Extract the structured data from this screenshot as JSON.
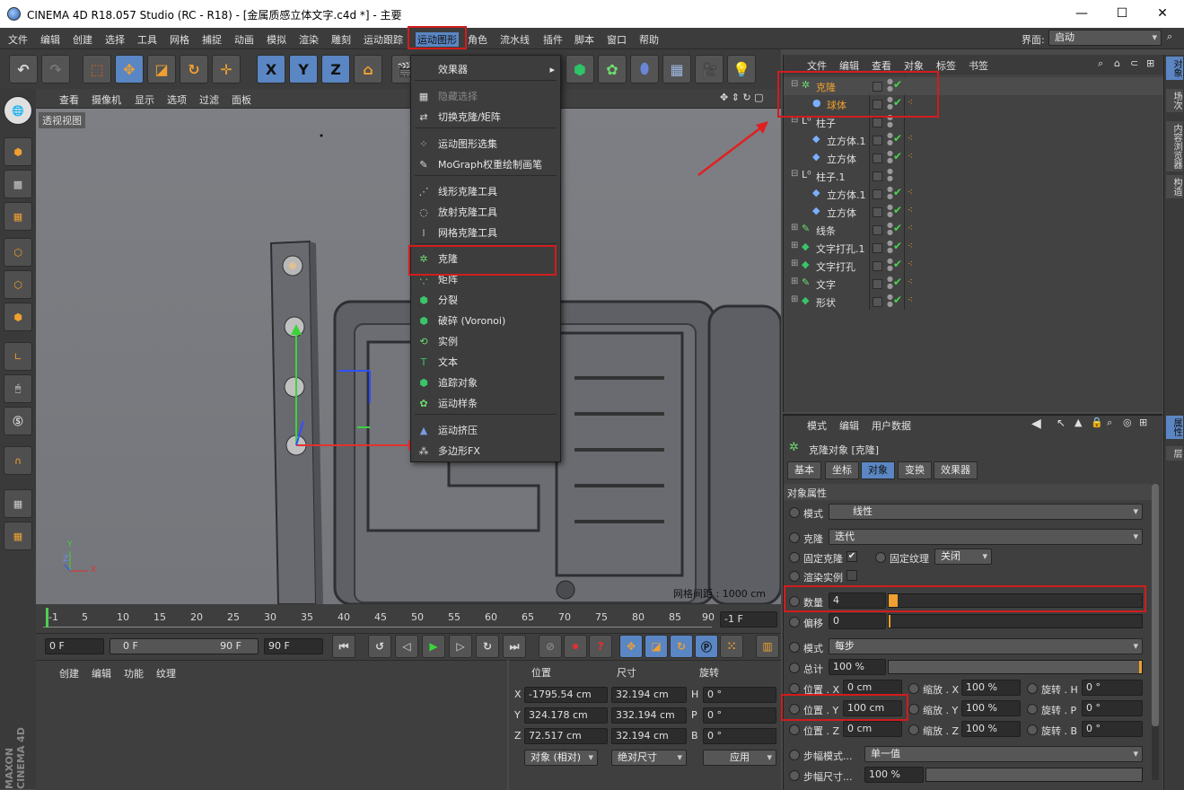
{
  "window": {
    "title": "CINEMA 4D R18.057 Studio (RC - R18) - [金属质感立体文字.c4d *] - 主要",
    "minimize": "—",
    "maximize": "☐",
    "close": "✕"
  },
  "menubar": {
    "items": [
      "文件",
      "编辑",
      "创建",
      "选择",
      "工具",
      "网格",
      "捕捉",
      "动画",
      "模拟",
      "渲染",
      "雕刻",
      "运动跟踪",
      "运动图形",
      "角色",
      "流水线",
      "插件",
      "脚本",
      "窗口",
      "帮助"
    ],
    "layout_label": "界面:",
    "layout_value": "启动"
  },
  "toolbar": {
    "x": "X",
    "y": "Y",
    "z": "Z"
  },
  "viewport": {
    "menu": [
      "查看",
      "摄像机",
      "显示",
      "选项",
      "过滤",
      "面板"
    ],
    "view_name": "透视视图",
    "grid_spacing": "网格间距 : 1000 cm",
    "axis_y": "Y",
    "axis_z": "Z",
    "axis_x": "X"
  },
  "dropdown": {
    "items": [
      {
        "label": "效果器",
        "submenu": true,
        "disabled": false,
        "icon": "effector-icon"
      },
      {
        "label": "隐藏选择",
        "disabled": true,
        "icon": "hide-selection-icon"
      },
      {
        "label": "切换克隆/矩阵",
        "disabled": false,
        "icon": "toggle-clone-icon"
      },
      {
        "label": "运动图形选集",
        "disabled": false,
        "icon": "mograph-selection-icon"
      },
      {
        "label": "MoGraph权重绘制画笔",
        "disabled": false,
        "icon": "weight-brush-icon"
      },
      {
        "label": "线形克隆工具",
        "disabled": false,
        "icon": "linear-clone-icon"
      },
      {
        "label": "放射克隆工具",
        "disabled": false,
        "icon": "radial-clone-icon"
      },
      {
        "label": "网格克隆工具",
        "disabled": false,
        "icon": "grid-clone-icon"
      },
      {
        "label": "克隆",
        "disabled": false,
        "icon": "cloner-icon"
      },
      {
        "label": "矩阵",
        "disabled": false,
        "icon": "matrix-icon"
      },
      {
        "label": "分裂",
        "disabled": false,
        "icon": "fracture-icon"
      },
      {
        "label": "破碎 (Voronoi)",
        "disabled": false,
        "icon": "voronoi-icon"
      },
      {
        "label": "实例",
        "disabled": false,
        "icon": "instance-icon"
      },
      {
        "label": "文本",
        "disabled": false,
        "icon": "text-icon"
      },
      {
        "label": "追踪对象",
        "disabled": false,
        "icon": "tracer-icon"
      },
      {
        "label": "运动样条",
        "disabled": false,
        "icon": "mospline-icon"
      },
      {
        "label": "运动挤压",
        "disabled": false,
        "icon": "extrude-icon"
      },
      {
        "label": "多边形FX",
        "disabled": false,
        "icon": "polyfx-icon"
      }
    ]
  },
  "timeline": {
    "ticks": [
      "-1",
      "5",
      "10",
      "15",
      "20",
      "25",
      "30",
      "35",
      "40",
      "45",
      "50",
      "55",
      "60",
      "65",
      "70",
      "75",
      "80",
      "85",
      "90"
    ],
    "current_frame": "-1 F"
  },
  "playbar": {
    "start": "0 F",
    "range_start": "0 F",
    "range_end": "90 F",
    "end": "90 F"
  },
  "material": {
    "menu": [
      "创建",
      "编辑",
      "功能",
      "纹理"
    ],
    "logo_line1": "MAXON",
    "logo_line2": "CINEMA 4D"
  },
  "coords": {
    "headers": [
      "位置",
      "尺寸",
      "旋转"
    ],
    "rows": [
      {
        "axis": "X",
        "pos": "-1795.54 cm",
        "size": "32.194 cm",
        "rlabel": "H",
        "rot": "0 °"
      },
      {
        "axis": "Y",
        "pos": "324.178 cm",
        "size": "332.194 cm",
        "rlabel": "P",
        "rot": "0 °"
      },
      {
        "axis": "Z",
        "pos": "72.517 cm",
        "size": "32.194 cm",
        "rlabel": "B",
        "rot": "0 °"
      }
    ],
    "mode": "对象 (相对)",
    "size_mode": "绝对尺寸",
    "apply": "应用"
  },
  "objects": {
    "menu": [
      "文件",
      "编辑",
      "查看",
      "对象",
      "标签",
      "书签"
    ],
    "rows": [
      {
        "name": "克隆",
        "indent": 0,
        "color": "#f0a030",
        "expand": "⊟"
      },
      {
        "name": "球体",
        "indent": 1,
        "color": "#f0a030",
        "expand": ""
      },
      {
        "name": "柱子",
        "indent": 0,
        "color": "#e0e0e0",
        "expand": "⊟"
      },
      {
        "name": "立方体.1",
        "indent": 1,
        "color": "#e0e0e0",
        "expand": ""
      },
      {
        "name": "立方体",
        "indent": 1,
        "color": "#e0e0e0",
        "expand": ""
      },
      {
        "name": "柱子.1",
        "indent": 0,
        "color": "#e0e0e0",
        "expand": "⊟"
      },
      {
        "name": "立方体.1",
        "indent": 1,
        "color": "#e0e0e0",
        "expand": ""
      },
      {
        "name": "立方体",
        "indent": 1,
        "color": "#e0e0e0",
        "expand": ""
      },
      {
        "name": "线条",
        "indent": 0,
        "color": "#e0e0e0",
        "expand": "⊞"
      },
      {
        "name": "文字打孔.1",
        "indent": 0,
        "color": "#e0e0e0",
        "expand": "⊞"
      },
      {
        "name": "文字打孔",
        "indent": 0,
        "color": "#e0e0e0",
        "expand": "⊞"
      },
      {
        "name": "文字",
        "indent": 0,
        "color": "#e0e0e0",
        "expand": "⊞"
      },
      {
        "name": "形状",
        "indent": 0,
        "color": "#e0e0e0",
        "expand": "⊞"
      }
    ]
  },
  "attributes": {
    "menu": [
      "模式",
      "编辑",
      "用户数据"
    ],
    "object_title": "克隆对象 [克隆]",
    "tabs": [
      "基本",
      "坐标",
      "对象",
      "变换",
      "效果器"
    ],
    "active_tab": "对象",
    "section": "对象属性",
    "mode_label": "模式",
    "mode_value": "线性",
    "clone_label": "克隆",
    "clone_value": "迭代",
    "fix_clone_label": "固定克隆",
    "fix_texture_label": "固定纹理",
    "fix_texture_value": "关闭",
    "render_instance_label": "渲染实例",
    "count_label": "数量",
    "count_value": "4",
    "offset_label": "偏移",
    "offset_value": "0",
    "step_mode_label": "模式",
    "step_mode_value": "每步",
    "total_label": "总计",
    "total_value": "100 %",
    "pos_x_label": "位置 . X",
    "pos_x": "0 cm",
    "scale_x_label": "缩放 . X",
    "scale_x": "100 %",
    "rot_h_label": "旋转 . H",
    "rot_h": "0 °",
    "pos_y_label": "位置 . Y",
    "pos_y": "100 cm",
    "scale_y_label": "缩放 . Y",
    "scale_y": "100 %",
    "rot_p_label": "旋转 . P",
    "rot_p": "0 °",
    "pos_z_label": "位置 . Z",
    "pos_z": "0 cm",
    "scale_z_label": "缩放 . Z",
    "scale_z": "100 %",
    "rot_b_label": "旋转 . B",
    "rot_b": "0 °",
    "step_mode2_label": "步幅模式...",
    "step_mode2_value": "单一值",
    "step_size_label": "步幅尺寸...",
    "step_size_value": "100 %"
  },
  "right_tabs": [
    "对象",
    "场次",
    "内容浏览器",
    "构造",
    "属性",
    "层"
  ],
  "colors": {
    "accent": "#5a86c4",
    "highlight_red": "#d21c1c",
    "orange": "#f0a030"
  }
}
